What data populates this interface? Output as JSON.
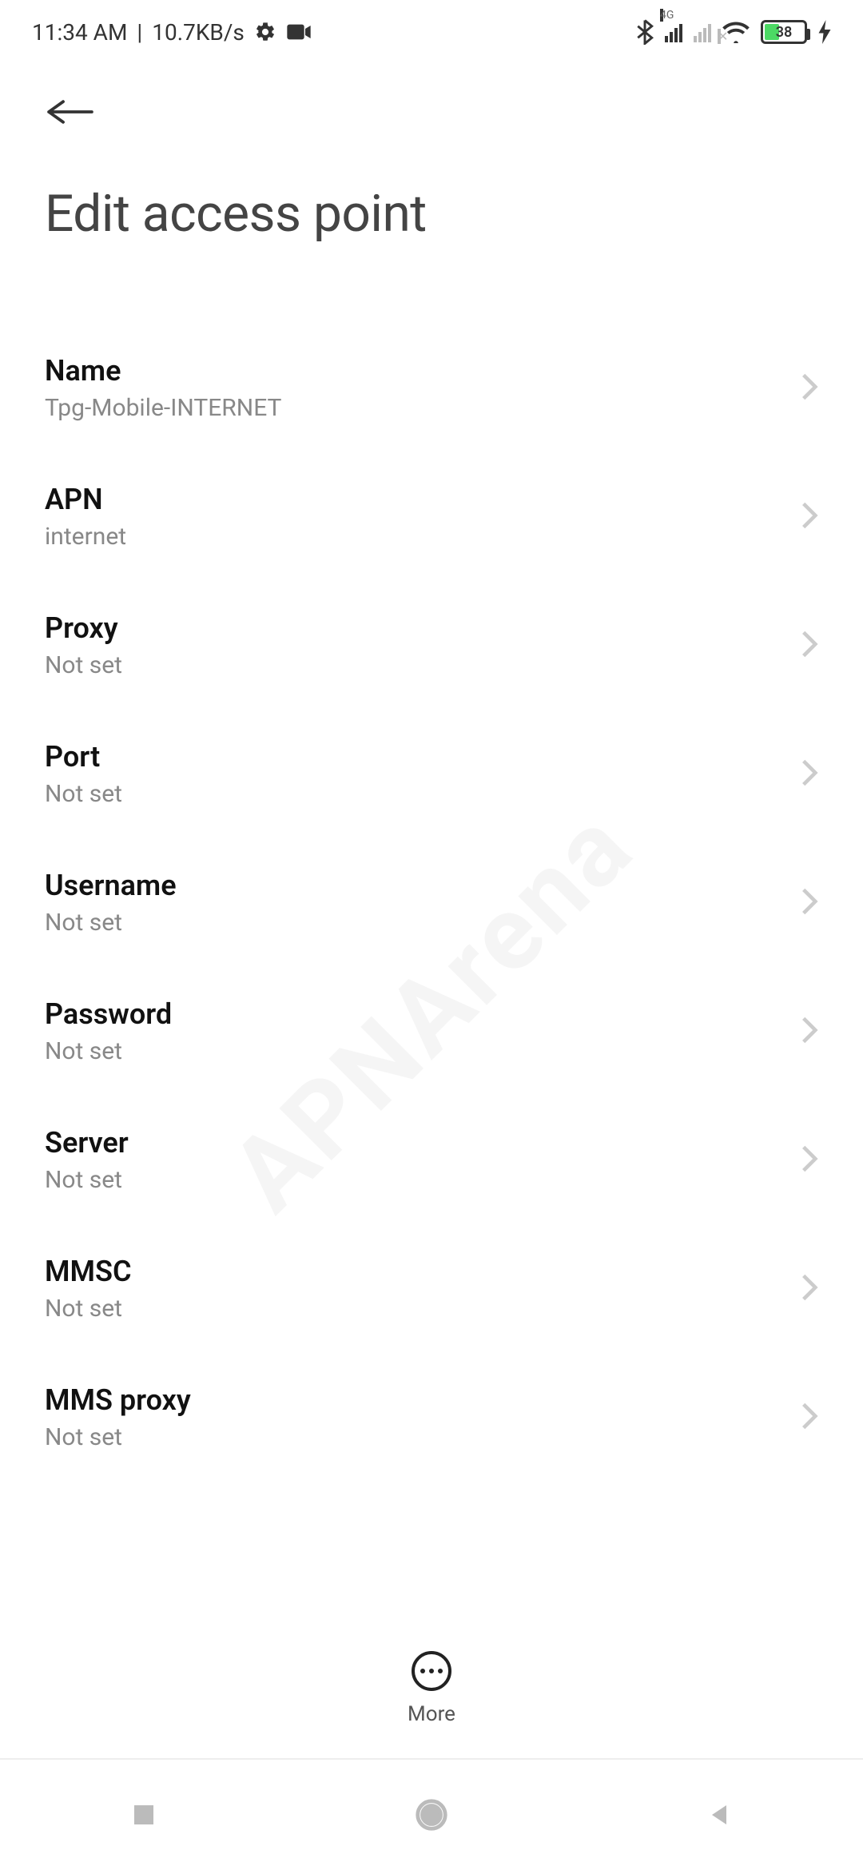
{
  "status_bar": {
    "time": "11:34 AM",
    "speed": "10.7KB/s",
    "network_type": "4G",
    "battery_pct": "38"
  },
  "header": {
    "title": "Edit access point"
  },
  "settings": [
    {
      "label": "Name",
      "value": "Tpg-Mobile-INTERNET"
    },
    {
      "label": "APN",
      "value": "internet"
    },
    {
      "label": "Proxy",
      "value": "Not set"
    },
    {
      "label": "Port",
      "value": "Not set"
    },
    {
      "label": "Username",
      "value": "Not set"
    },
    {
      "label": "Password",
      "value": "Not set"
    },
    {
      "label": "Server",
      "value": "Not set"
    },
    {
      "label": "MMSC",
      "value": "Not set"
    },
    {
      "label": "MMS proxy",
      "value": "Not set"
    }
  ],
  "bottom_action": {
    "label": "More"
  },
  "watermark": "APNArena"
}
